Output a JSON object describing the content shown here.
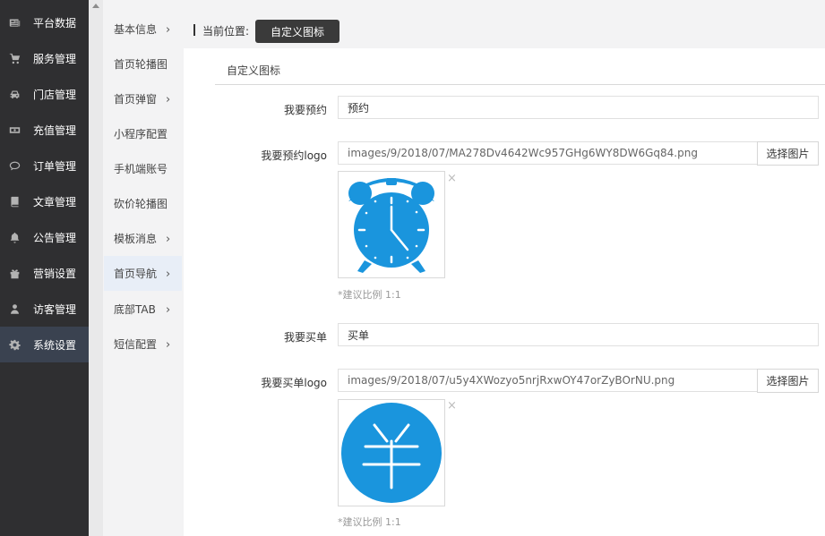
{
  "sidebar": {
    "items": [
      {
        "label": "平台数据",
        "icon": "newspaper-icon"
      },
      {
        "label": "服务管理",
        "icon": "cart-icon"
      },
      {
        "label": "门店管理",
        "icon": "car-icon"
      },
      {
        "label": "充值管理",
        "icon": "money-icon"
      },
      {
        "label": "订单管理",
        "icon": "comment-icon"
      },
      {
        "label": "文章管理",
        "icon": "book-icon"
      },
      {
        "label": "公告管理",
        "icon": "bell-icon"
      },
      {
        "label": "营销设置",
        "icon": "gift-icon"
      },
      {
        "label": "访客管理",
        "icon": "user-icon"
      },
      {
        "label": "系统设置",
        "icon": "gear-icon",
        "active": true
      }
    ]
  },
  "subnav": {
    "items": [
      {
        "label": "基本信息",
        "chevron": true
      },
      {
        "label": "首页轮播图",
        "chevron": false
      },
      {
        "label": "首页弹窗",
        "chevron": true
      },
      {
        "label": "小程序配置",
        "chevron": false
      },
      {
        "label": "手机端账号",
        "chevron": false
      },
      {
        "label": "砍价轮播图",
        "chevron": false
      },
      {
        "label": "模板消息",
        "chevron": true
      },
      {
        "label": "首页导航",
        "chevron": true,
        "active": true
      },
      {
        "label": "底部TAB",
        "chevron": true
      },
      {
        "label": "短信配置",
        "chevron": true
      }
    ]
  },
  "breadcrumb": {
    "label": "当前位置:",
    "current": "自定义图标"
  },
  "section": {
    "title": "自定义图标"
  },
  "form": {
    "booking_label": "我要预约",
    "booking_value": "预约",
    "booking_logo_label": "我要预约logo",
    "booking_logo_path": "images/9/2018/07/MA278Dv4642Wc957GHg6WY8DW6Gq84.png",
    "pick_label": "选择图片",
    "hint": "*建议比例 1:1",
    "pay_label": "我要买单",
    "pay_value": "买单",
    "pay_logo_label": "我要买单logo",
    "pay_logo_path": "images/9/2018/07/u5y4XWozyo5nrjRxwOY47orZyBOrNU.png",
    "close_glyph": "×"
  },
  "colors": {
    "sidebar_bg": "#2f2f31",
    "accent_blue": "#1a95dd",
    "crumb_button": "#3a3a3a"
  }
}
